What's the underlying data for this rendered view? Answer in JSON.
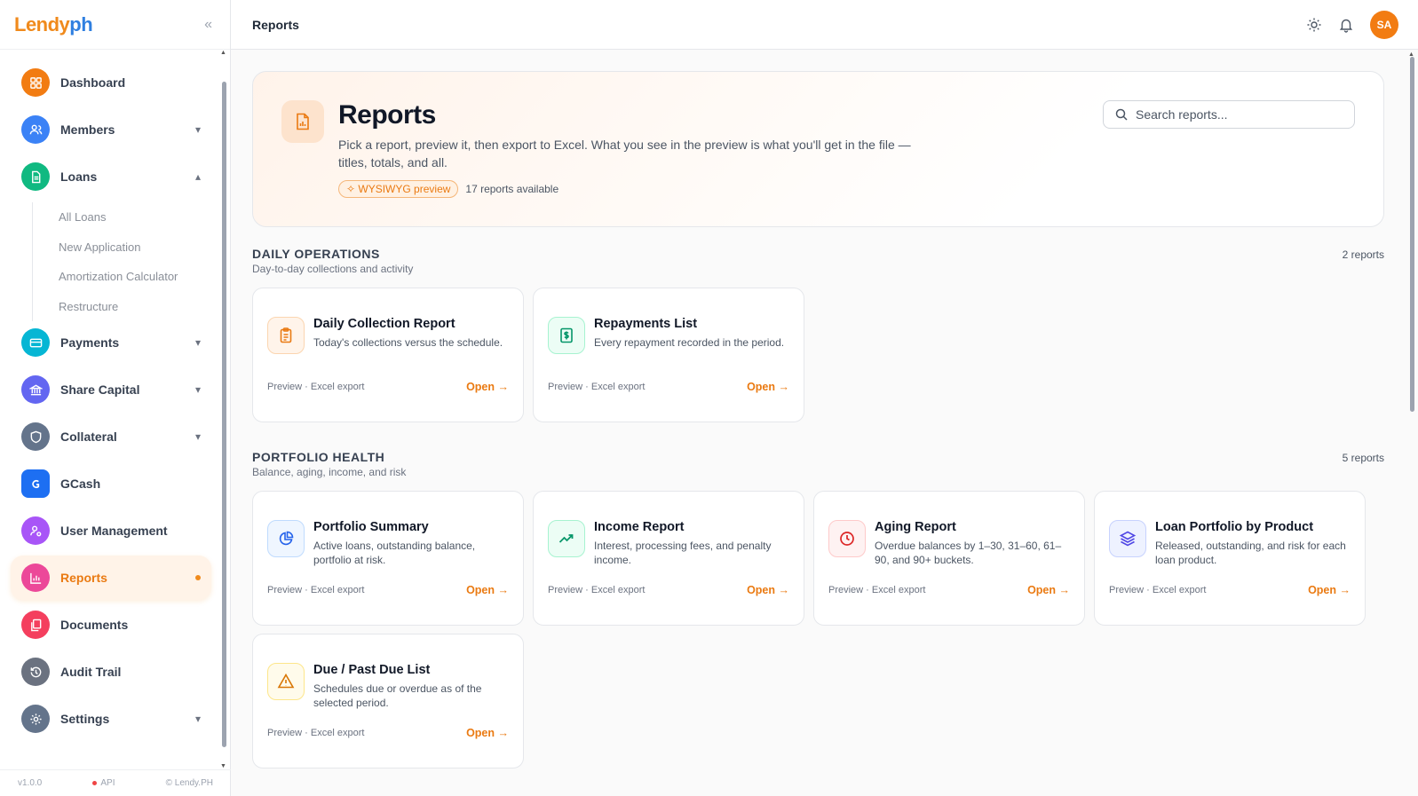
{
  "brand": {
    "part1": "Lendy",
    "part2": "ph"
  },
  "sidebar": {
    "items": [
      {
        "label": "Dashboard",
        "color": "#f27c12",
        "icon": "dashboard-icon",
        "chevron": ""
      },
      {
        "label": "Members",
        "color": "#3b82f6",
        "icon": "users-icon",
        "chevron": "⌄"
      },
      {
        "label": "Loans",
        "color": "#10b981",
        "icon": "document-icon",
        "chevron": "⌃"
      },
      {
        "label": "Payments",
        "color": "#06b6d4",
        "icon": "credit-card-icon",
        "chevron": "⌄"
      },
      {
        "label": "Share Capital",
        "color": "#6366f1",
        "icon": "bank-icon",
        "chevron": "⌄"
      },
      {
        "label": "Collateral",
        "color": "#64748b",
        "icon": "shield-icon",
        "chevron": "⌄"
      },
      {
        "label": "GCash",
        "color": "#1d6ff2",
        "icon": "gcash-icon",
        "chevron": ""
      },
      {
        "label": "User Management",
        "color": "#a855f7",
        "icon": "user-cog-icon",
        "chevron": ""
      },
      {
        "label": "Reports",
        "color": "#ec4899",
        "icon": "bar-chart-icon",
        "chevron": ""
      },
      {
        "label": "Documents",
        "color": "#f43f5e",
        "icon": "documents-icon",
        "chevron": ""
      },
      {
        "label": "Audit Trail",
        "color": "#6b7280",
        "icon": "history-icon",
        "chevron": ""
      },
      {
        "label": "Settings",
        "color": "#64748b",
        "icon": "gear-icon",
        "chevron": "⌄"
      }
    ],
    "loans_sub": [
      "All Loans",
      "New Application",
      "Amortization Calculator",
      "Restructure"
    ],
    "footer": {
      "version": "v1.0.0",
      "api": "API",
      "copyright": "© Lendy.PH"
    }
  },
  "topbar": {
    "title": "Reports",
    "avatar": "SA"
  },
  "hero": {
    "title": "Reports",
    "description": "Pick a report, preview it, then export to Excel. What you see in the preview is what you'll get in the file — titles, totals, and all.",
    "badge": "WYSIWYG preview",
    "count": "17 reports available",
    "search_placeholder": "Search reports..."
  },
  "sections": [
    {
      "title": "DAILY OPERATIONS",
      "subtitle": "Day-to-day collections and activity",
      "count": "2 reports",
      "cards": [
        {
          "title": "Daily Collection Report",
          "desc": "Today's collections versus the schedule.",
          "meta": "Preview · Excel export",
          "open": "Open →",
          "icon": "clipboard-icon",
          "color": "#ea7a12",
          "bg": "#fff4ea",
          "border": "#fbd5b0"
        },
        {
          "title": "Repayments List",
          "desc": "Every repayment recorded in the period.",
          "meta": "Preview · Excel export",
          "open": "Open →",
          "icon": "receipt-dollar-icon",
          "color": "#059669",
          "bg": "#ecfdf5",
          "border": "#a7f3d0"
        }
      ]
    },
    {
      "title": "PORTFOLIO HEALTH",
      "subtitle": "Balance, aging, income, and risk",
      "count": "5 reports",
      "cards": [
        {
          "title": "Portfolio Summary",
          "desc": "Active loans, outstanding balance, portfolio at risk.",
          "meta": "Preview · Excel export",
          "open": "Open →",
          "icon": "pie-chart-icon",
          "color": "#2563eb",
          "bg": "#eff6ff",
          "border": "#bfdbfe"
        },
        {
          "title": "Income Report",
          "desc": "Interest, processing fees, and penalty income.",
          "meta": "Preview · Excel export",
          "open": "Open →",
          "icon": "trending-up-icon",
          "color": "#059669",
          "bg": "#ecfdf5",
          "border": "#a7f3d0"
        },
        {
          "title": "Aging Report",
          "desc": "Overdue balances by 1–30, 31–60, 61–90, and 90+ buckets.",
          "meta": "Preview · Excel export",
          "open": "Open →",
          "icon": "clock-icon",
          "color": "#dc2626",
          "bg": "#fef2f2",
          "border": "#fecaca"
        },
        {
          "title": "Loan Portfolio by Product",
          "desc": "Released, outstanding, and risk for each loan product.",
          "meta": "Preview · Excel export",
          "open": "Open →",
          "icon": "layers-icon",
          "color": "#4f46e5",
          "bg": "#eef2ff",
          "border": "#c7d2fe"
        },
        {
          "title": "Due / Past Due List",
          "desc": "Schedules due or overdue as of the selected period.",
          "meta": "Preview · Excel export",
          "open": "Open →",
          "icon": "warning-icon",
          "color": "#d97706",
          "bg": "#fffbeb",
          "border": "#fde68a"
        }
      ]
    }
  ]
}
